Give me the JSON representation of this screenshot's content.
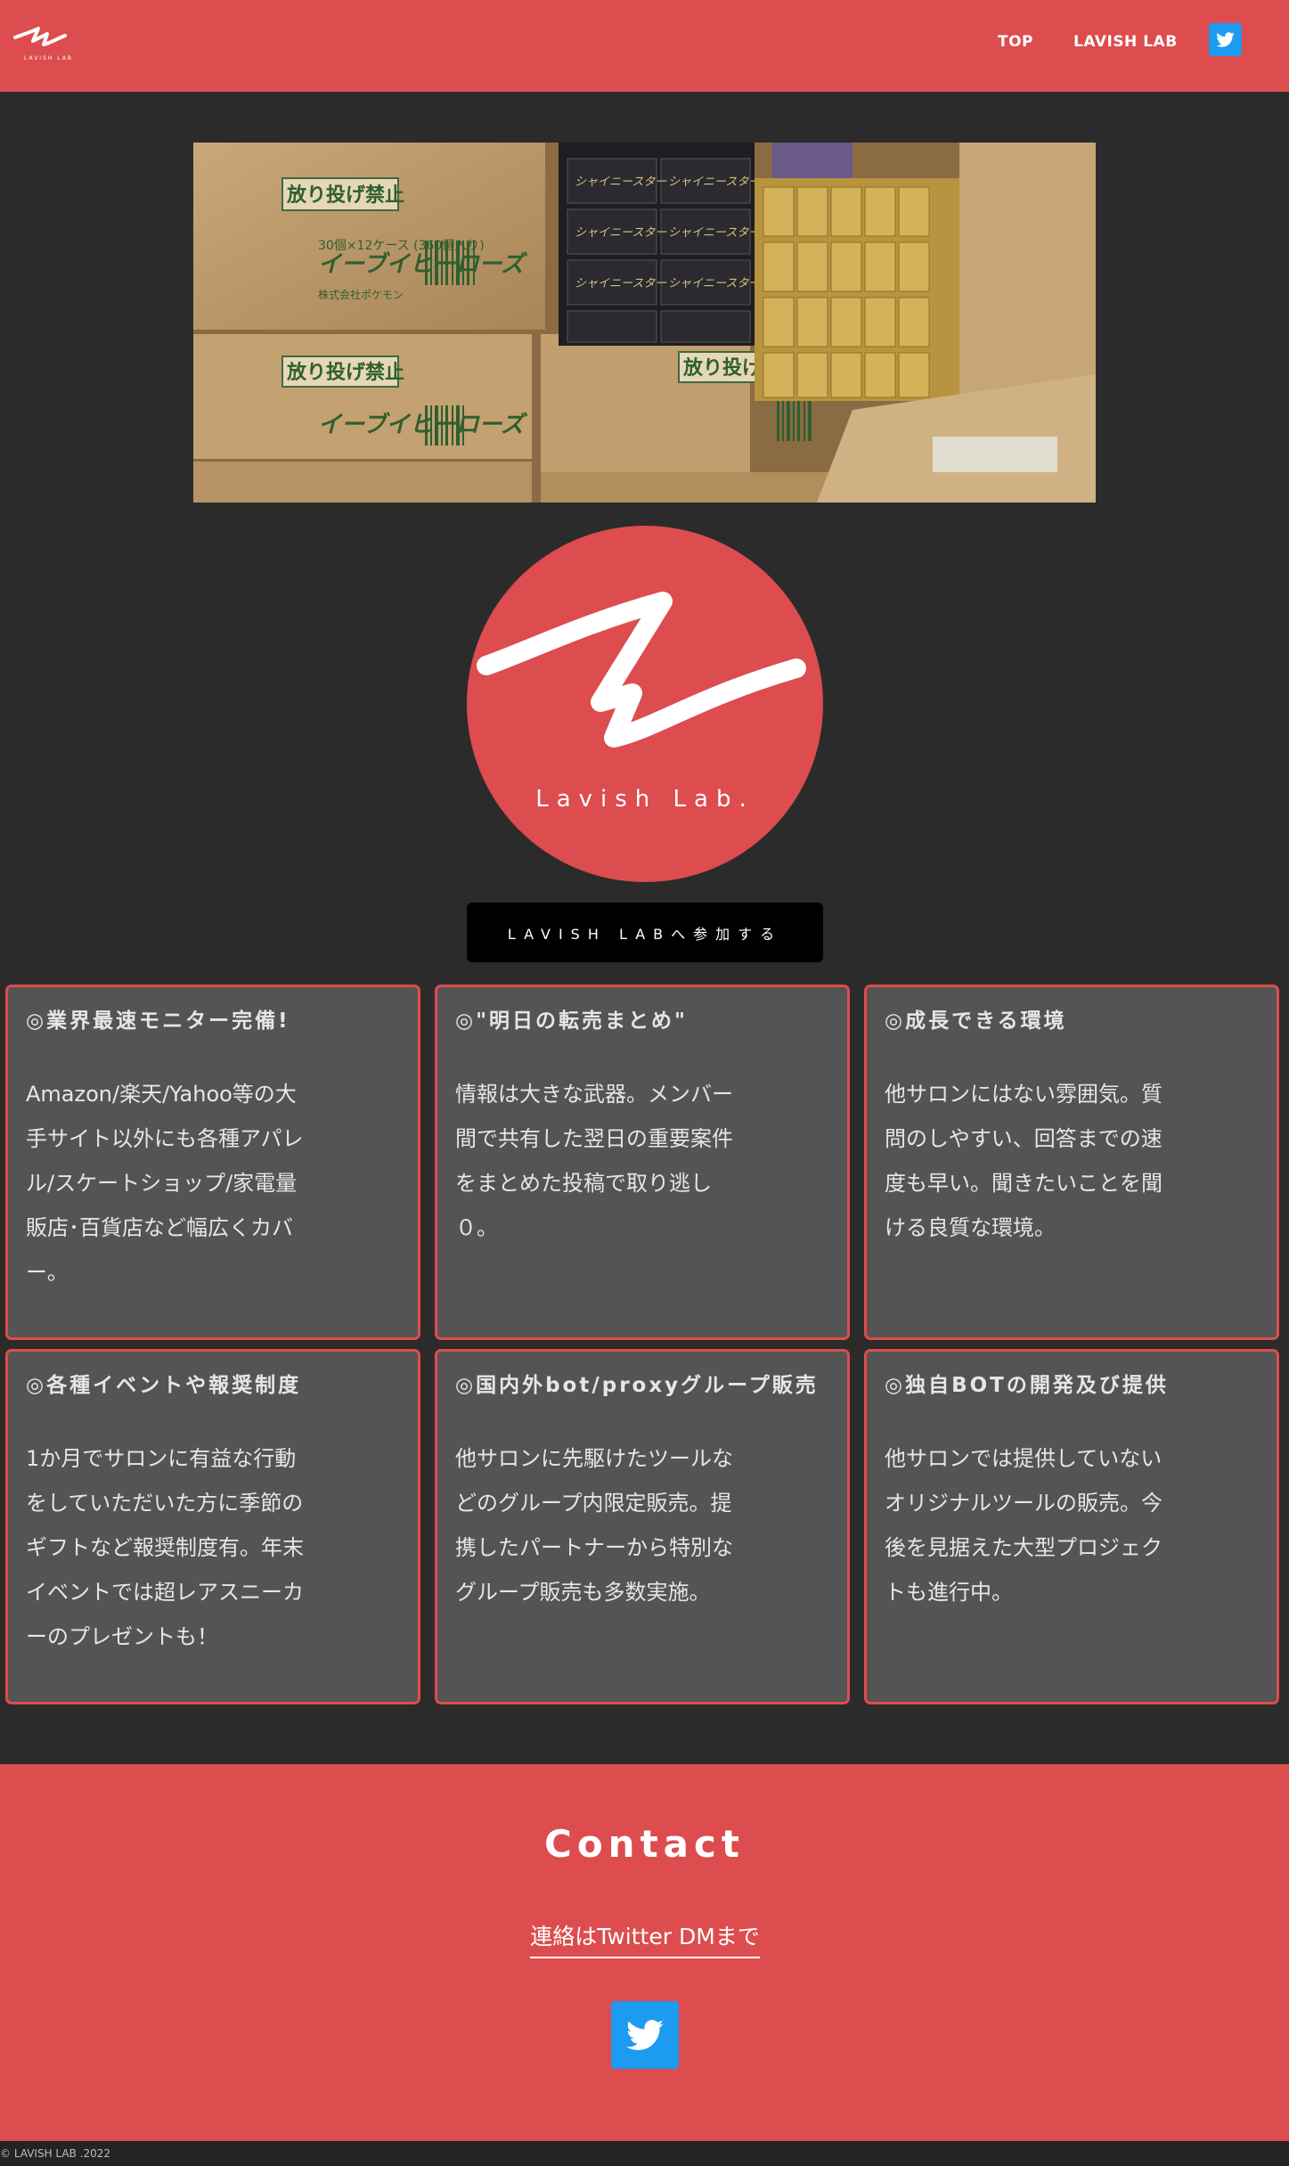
{
  "header": {
    "nav": [
      {
        "label": "TOP"
      },
      {
        "label": "LAVISH LAB"
      }
    ],
    "twitter_icon": "twitter-icon"
  },
  "hero": {
    "box_labels": [
      "放り投げ禁止",
      "放り投げ禁止",
      "放り投げ禁止"
    ],
    "box_spec": "30個×12ケース (360個入り)",
    "box_maker": "株式会社ポケモン",
    "product": "イーブイヒーローズ",
    "pack_name": "シャイニースター"
  },
  "brand": {
    "logo_text": "Lavish Lab.",
    "join_button": "LAVISH LABへ参加する"
  },
  "features": [
    {
      "title": "◎業界最速モニター完備!",
      "lines": [
        "Amazon/楽天/Yahoo等の大",
        "手サイト以外にも各種アパレ",
        "ル/スケートショップ/家電量",
        "販店･百貨店など幅広くカバ",
        "ー。"
      ]
    },
    {
      "title": "◎\"明日の転売まとめ\"",
      "lines": [
        "情報は大きな武器。メンバー",
        "間で共有した翌日の重要案件",
        "をまとめた投稿で取り逃し",
        "０。"
      ]
    },
    {
      "title": "◎成長できる環境",
      "lines": [
        "他サロンにはない雰囲気。質",
        "問のしやすい、回答までの速",
        "度も早い。聞きたいことを聞",
        "ける良質な環境。"
      ]
    },
    {
      "title": "◎各種イベントや報奨制度",
      "lines": [
        "1か月でサロンに有益な行動",
        "をしていただいた方に季節の",
        "ギフトなど報奨制度有。年末",
        "イベントでは超レアスニーカ",
        "ーのプレゼントも！"
      ]
    },
    {
      "title": "◎国内外bot/proxyグループ販売",
      "lines": [
        "他サロンに先駆けたツールな",
        "どのグループ内限定販売。提",
        "携したパートナーから特別な",
        "グループ販売も多数実施。"
      ]
    },
    {
      "title": "◎独自BOTの開発及び提供",
      "lines": [
        "他サロンでは提供していない",
        "オリジナルツールの販売。今",
        "後を見据えた大型プロジェク",
        "トも進行中。"
      ]
    }
  ],
  "contact": {
    "title": "Contact",
    "link": "連絡はTwitter DMまで",
    "twitter_icon": "twitter-icon"
  },
  "footer": {
    "copyright": "© LAVISH LAB .2022"
  },
  "colors": {
    "brand_red": "#dd4c4e",
    "background": "#2b2b2b",
    "card": "#545454",
    "twitter": "#1d9bf0"
  }
}
